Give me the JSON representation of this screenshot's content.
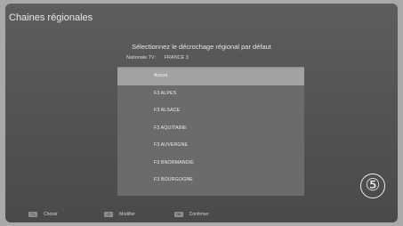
{
  "window": {
    "title": "Chaines régionales"
  },
  "dialog": {
    "heading": "Sélectionnez le décrochage régional par défaut",
    "national_label": "Nationale TV:",
    "national_value": "FRANCE 3"
  },
  "list": {
    "items": [
      {
        "label": "Aucun",
        "selected": true
      },
      {
        "label": "F3 ALPES"
      },
      {
        "label": "F3 ALSACE"
      },
      {
        "label": "F3 AQUITAINE"
      },
      {
        "label": "F3 AUVERGNE"
      },
      {
        "label": "F3 BNORMANDIE"
      },
      {
        "label": "F3 BOURGOGNE"
      }
    ]
  },
  "step_badge": "⑤",
  "footer": {
    "choose": {
      "keys": "▽△",
      "label": "Choisir"
    },
    "modify": {
      "keys": "◁▷",
      "label": "Modifier"
    },
    "confirm": {
      "keys": "OK",
      "label": "Confirmer"
    }
  }
}
